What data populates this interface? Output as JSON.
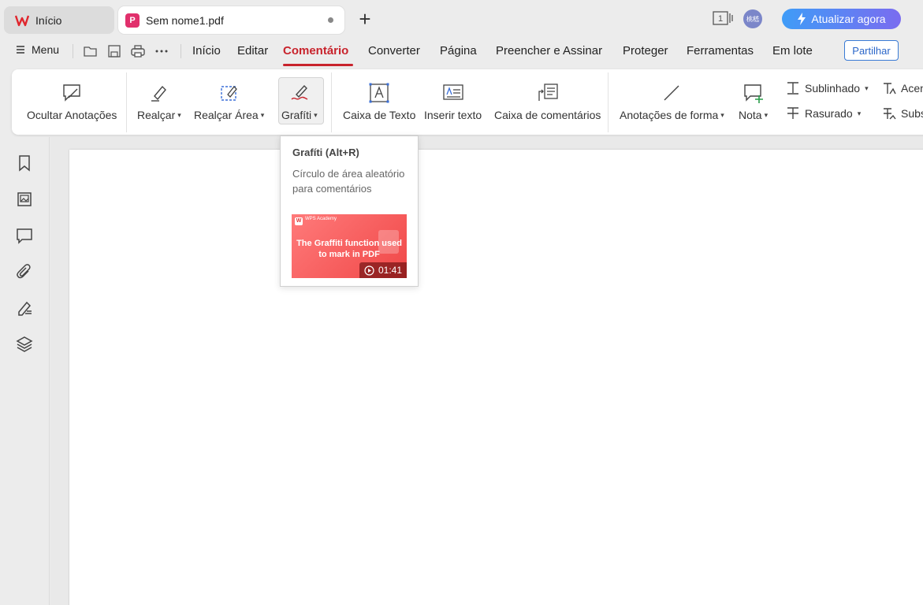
{
  "tabs": {
    "home_label": "Início",
    "doc_label": "Sem nome1.pdf",
    "pdf_icon_glyph": "P",
    "add_glyph": "+"
  },
  "header": {
    "avatar_text": "桃嵇",
    "upgrade_label": "Atualizar agora",
    "win_count": "1"
  },
  "menu": {
    "menu_label": "Menu",
    "items": [
      "Início",
      "Editar",
      "Comentário",
      "Converter",
      "Página",
      "Preencher e Assinar",
      "Proteger",
      "Ferramentas",
      "Em lote"
    ],
    "active": "Comentário",
    "share_label": "Partilhar"
  },
  "ribbon": {
    "hide_annotations": "Ocultar Anotações",
    "highlight": "Realçar",
    "highlight_area": "Realçar Área",
    "graffiti": "Grafíti",
    "text_box": "Caixa de Texto",
    "insert_text": "Inserir texto",
    "comment_box": "Caixa de comentários",
    "shape_annotations": "Anotações de forma",
    "note": "Nota",
    "underline": "Sublinhado",
    "strikethrough": "Rasurado",
    "accent_partial": "Acen",
    "subst_partial": "Subs"
  },
  "tooltip": {
    "title": "Grafíti (Alt+R)",
    "description": "Círculo de área aleatório para comentários",
    "video_brand": "WPS Academy",
    "video_title": "The Graffiti function used to mark in PDF",
    "video_duration": "01:41"
  },
  "colors": {
    "accent_red": "#c8232c",
    "share_blue": "#2a66c9",
    "upgrade_gradient_start": "#3f9cf7",
    "upgrade_gradient_end": "#7a6cf0"
  },
  "icons": {
    "sidebar": [
      "bookmark-icon",
      "image-icon",
      "comment-icon",
      "attachment-icon",
      "signature-icon",
      "layers-icon"
    ]
  }
}
